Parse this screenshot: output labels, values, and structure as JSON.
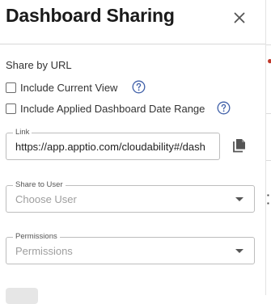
{
  "dialog": {
    "title": "Dashboard Sharing",
    "close_icon": "close-icon"
  },
  "share_by_url": {
    "label": "Share by URL",
    "include_current_view": {
      "label": "Include Current View",
      "checked": false
    },
    "include_date_range": {
      "label": "Include Applied Dashboard Date Range",
      "checked": false
    },
    "help_icon": "help-circle-icon"
  },
  "link": {
    "legend": "Link",
    "value": "https://app.apptio.com/cloudability#/dash",
    "copy_icon": "copy-icon"
  },
  "share_to_user": {
    "legend": "Share to User",
    "placeholder": "Choose User"
  },
  "permissions": {
    "legend": "Permissions",
    "placeholder": "Permissions"
  },
  "colors": {
    "text": "#212121",
    "border": "#bdbdbd",
    "help_icon": "#3f5fa8",
    "placeholder": "#9e9e9e"
  }
}
